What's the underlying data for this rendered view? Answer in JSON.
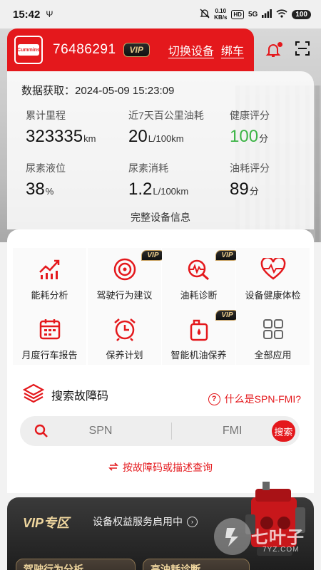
{
  "status_bar": {
    "time": "15:42",
    "net_speed_value": "0.10",
    "net_speed_unit": "KB/s",
    "hd": "HD",
    "signal": "5G",
    "battery": "100"
  },
  "header": {
    "logo_text": "Cummins",
    "device_id": "76486291",
    "vip_label": "VIP",
    "switch_device": "切换设备",
    "bind": "绑车"
  },
  "data_card": {
    "time_label": "数据获取：",
    "time_value": "2024-05-09 15:23:09",
    "metrics": [
      {
        "label": "累计里程",
        "value": "323335",
        "unit": "km"
      },
      {
        "label": "近7天百公里油耗",
        "value": "20",
        "unit": "L/100km"
      },
      {
        "label": "健康评分",
        "value": "100",
        "unit": "分"
      },
      {
        "label": "尿素液位",
        "value": "38",
        "unit": "%"
      },
      {
        "label": "尿素消耗",
        "value": "1.2",
        "unit": "L/100km"
      },
      {
        "label": "油耗评分",
        "value": "89",
        "unit": "分"
      }
    ],
    "full_info": "完整设备信息"
  },
  "functions": [
    {
      "label": "能耗分析",
      "vip": "",
      "icon": "chart-line-icon"
    },
    {
      "label": "驾驶行为建议",
      "vip": "VIP",
      "icon": "steering-wheel-icon"
    },
    {
      "label": "油耗诊断",
      "vip": "VIP",
      "icon": "fuel-diagnosis-icon"
    },
    {
      "label": "设备健康体检",
      "vip": "",
      "icon": "heart-pulse-icon"
    },
    {
      "label": "月度行车报告",
      "vip": "",
      "icon": "calendar-icon"
    },
    {
      "label": "保养计划",
      "vip": "",
      "icon": "alarm-clock-icon"
    },
    {
      "label": "智能机油保养",
      "vip": "VIP",
      "icon": "oil-can-icon"
    },
    {
      "label": "全部应用",
      "vip": "",
      "icon": "grid-apps-icon"
    }
  ],
  "search": {
    "title": "搜索故障码",
    "help": "什么是SPN-FMI?",
    "help_mark": "?",
    "spn_placeholder": "SPN",
    "fmi_placeholder": "FMI",
    "button": "搜索",
    "desc_query": "按故障码或描述查询"
  },
  "vip_section": {
    "title": "VIP专区",
    "subtitle": "设备权益服务启用中",
    "arrow": "›",
    "cards": [
      "驾驶行为分析",
      "高油耗诊断"
    ]
  },
  "watermark": {
    "text": "七叶子",
    "sub": "7YZ.COM"
  },
  "colors": {
    "brand_red": "#e4181c",
    "vip_gold": "#e8c98a",
    "score_green": "#3cb446"
  }
}
